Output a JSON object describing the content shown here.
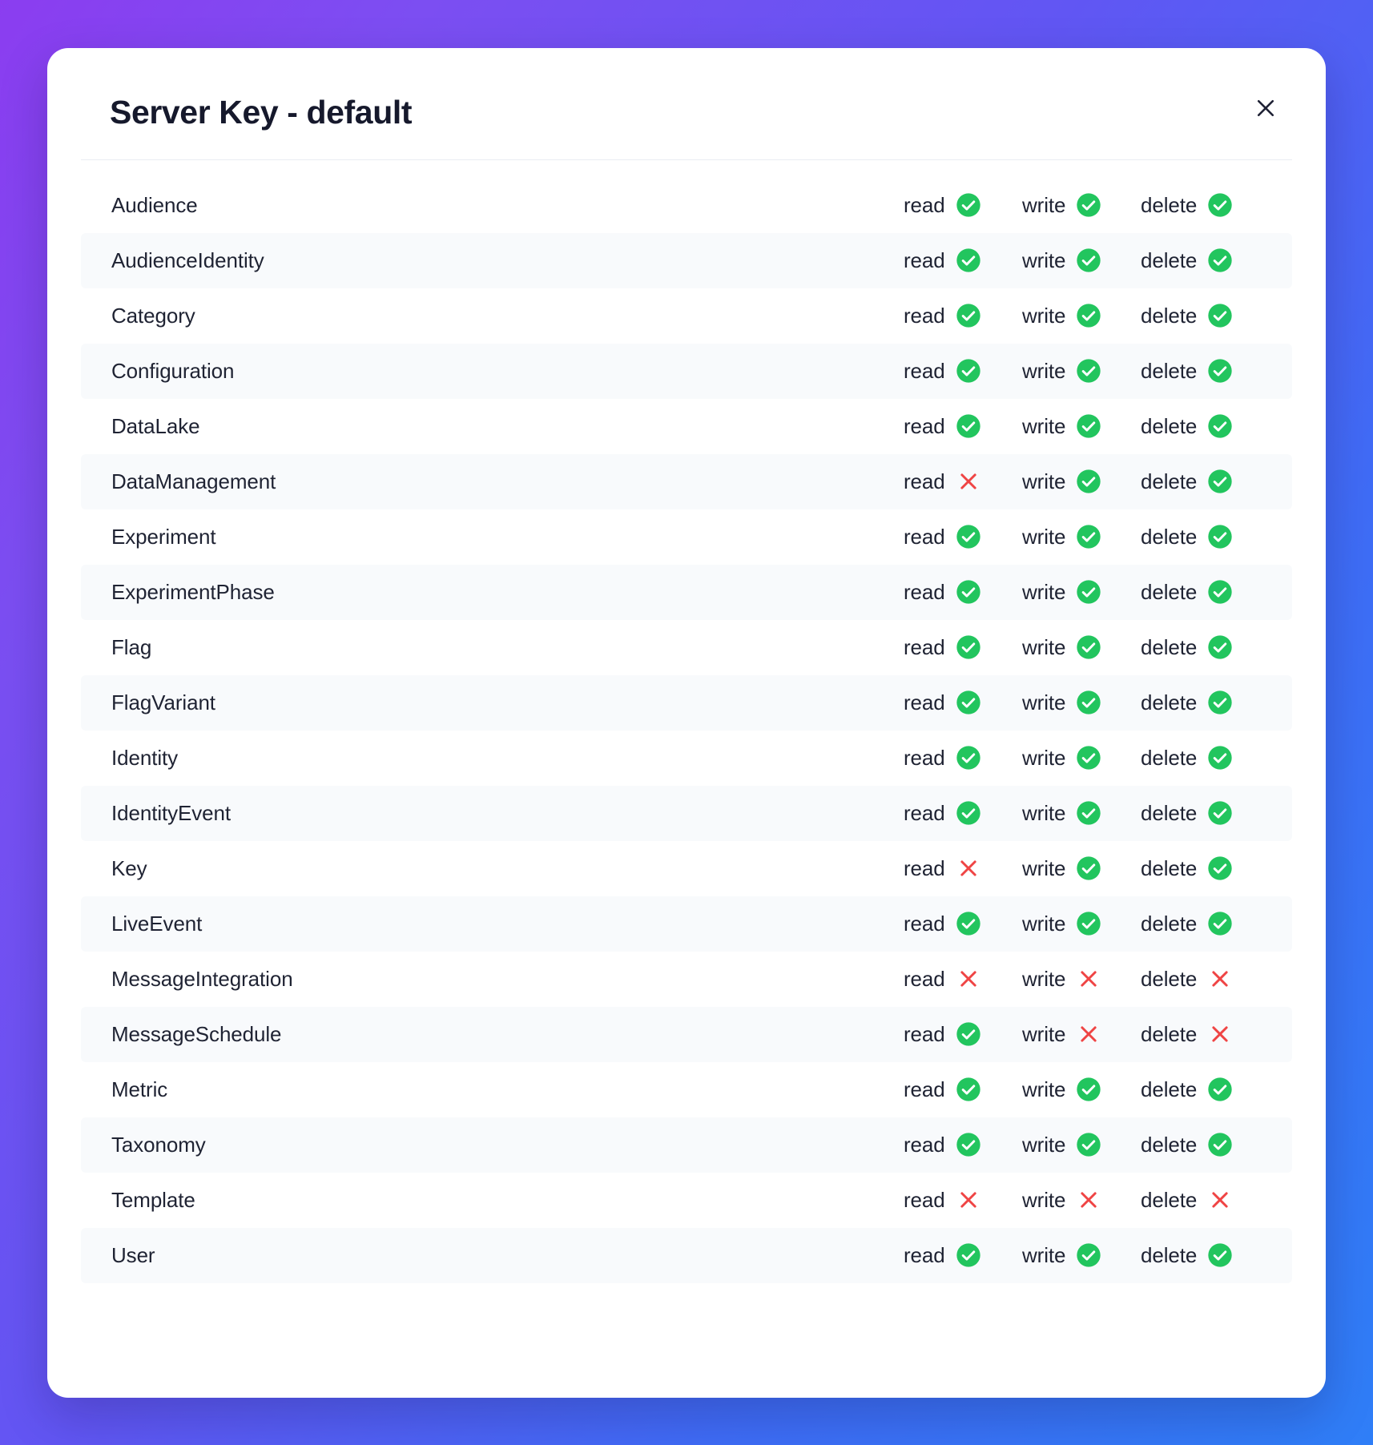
{
  "dialog": {
    "title": "Server Key - default",
    "close_label": "close-icon"
  },
  "columns": [
    "read",
    "write",
    "delete"
  ],
  "icons": {
    "allowed": "check-circle-icon",
    "denied": "x-icon"
  },
  "colors": {
    "allowed": "#22c55e",
    "denied": "#ef4444",
    "title": "#16192c",
    "row_stripe": "#f8fafc",
    "background_gradient_start": "#8b3df0",
    "background_gradient_end": "#2f7ef7"
  },
  "permissions": [
    {
      "resource": "Audience",
      "read": true,
      "write": true,
      "delete": true
    },
    {
      "resource": "AudienceIdentity",
      "read": true,
      "write": true,
      "delete": true
    },
    {
      "resource": "Category",
      "read": true,
      "write": true,
      "delete": true
    },
    {
      "resource": "Configuration",
      "read": true,
      "write": true,
      "delete": true
    },
    {
      "resource": "DataLake",
      "read": true,
      "write": true,
      "delete": true
    },
    {
      "resource": "DataManagement",
      "read": false,
      "write": true,
      "delete": true
    },
    {
      "resource": "Experiment",
      "read": true,
      "write": true,
      "delete": true
    },
    {
      "resource": "ExperimentPhase",
      "read": true,
      "write": true,
      "delete": true
    },
    {
      "resource": "Flag",
      "read": true,
      "write": true,
      "delete": true
    },
    {
      "resource": "FlagVariant",
      "read": true,
      "write": true,
      "delete": true
    },
    {
      "resource": "Identity",
      "read": true,
      "write": true,
      "delete": true
    },
    {
      "resource": "IdentityEvent",
      "read": true,
      "write": true,
      "delete": true
    },
    {
      "resource": "Key",
      "read": false,
      "write": true,
      "delete": true
    },
    {
      "resource": "LiveEvent",
      "read": true,
      "write": true,
      "delete": true
    },
    {
      "resource": "MessageIntegration",
      "read": false,
      "write": false,
      "delete": false
    },
    {
      "resource": "MessageSchedule",
      "read": true,
      "write": false,
      "delete": false
    },
    {
      "resource": "Metric",
      "read": true,
      "write": true,
      "delete": true
    },
    {
      "resource": "Taxonomy",
      "read": true,
      "write": true,
      "delete": true
    },
    {
      "resource": "Template",
      "read": false,
      "write": false,
      "delete": false
    },
    {
      "resource": "User",
      "read": true,
      "write": true,
      "delete": true
    }
  ]
}
